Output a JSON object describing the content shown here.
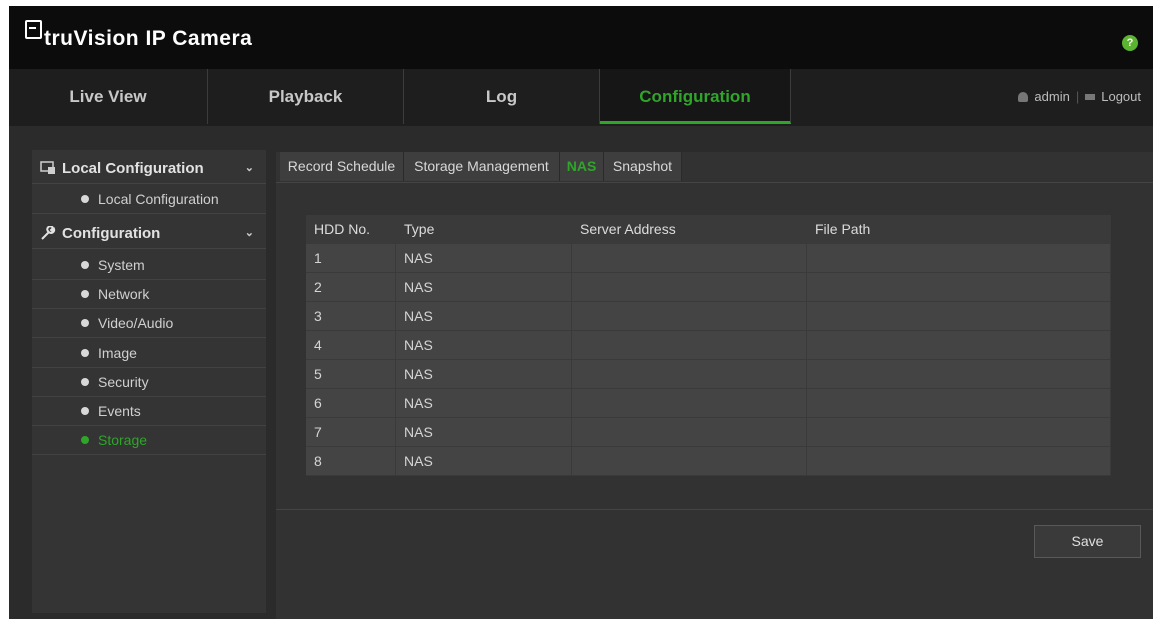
{
  "app": {
    "title": "truVision IP Camera"
  },
  "nav": {
    "tabs": [
      {
        "label": "Live View"
      },
      {
        "label": "Playback"
      },
      {
        "label": "Log"
      },
      {
        "label": "Configuration",
        "active": true
      }
    ],
    "user": "admin",
    "logout": "Logout",
    "help": "?"
  },
  "sidebar": {
    "groups": [
      {
        "label": "Local Configuration",
        "icon": "local-config-icon",
        "items": [
          {
            "label": "Local Configuration"
          }
        ]
      },
      {
        "label": "Configuration",
        "icon": "wrench-icon",
        "items": [
          {
            "label": "System"
          },
          {
            "label": "Network"
          },
          {
            "label": "Video/Audio"
          },
          {
            "label": "Image"
          },
          {
            "label": "Security"
          },
          {
            "label": "Events"
          },
          {
            "label": "Storage",
            "active": true
          }
        ]
      }
    ]
  },
  "subtabs": [
    {
      "label": "Record Schedule"
    },
    {
      "label": "Storage Management"
    },
    {
      "label": "NAS",
      "active": true
    },
    {
      "label": "Snapshot"
    }
  ],
  "table": {
    "headers": [
      "HDD No.",
      "Type",
      "Server Address",
      "File Path"
    ],
    "rows": [
      [
        "1",
        "NAS",
        "",
        ""
      ],
      [
        "2",
        "NAS",
        "",
        ""
      ],
      [
        "3",
        "NAS",
        "",
        ""
      ],
      [
        "4",
        "NAS",
        "",
        ""
      ],
      [
        "5",
        "NAS",
        "",
        ""
      ],
      [
        "6",
        "NAS",
        "",
        ""
      ],
      [
        "7",
        "NAS",
        "",
        ""
      ],
      [
        "8",
        "NAS",
        "",
        ""
      ]
    ]
  },
  "buttons": {
    "save": "Save"
  },
  "colors": {
    "accent": "#2fa52a",
    "header_bg": "#0c0c0c",
    "panel_bg": "#323232"
  }
}
